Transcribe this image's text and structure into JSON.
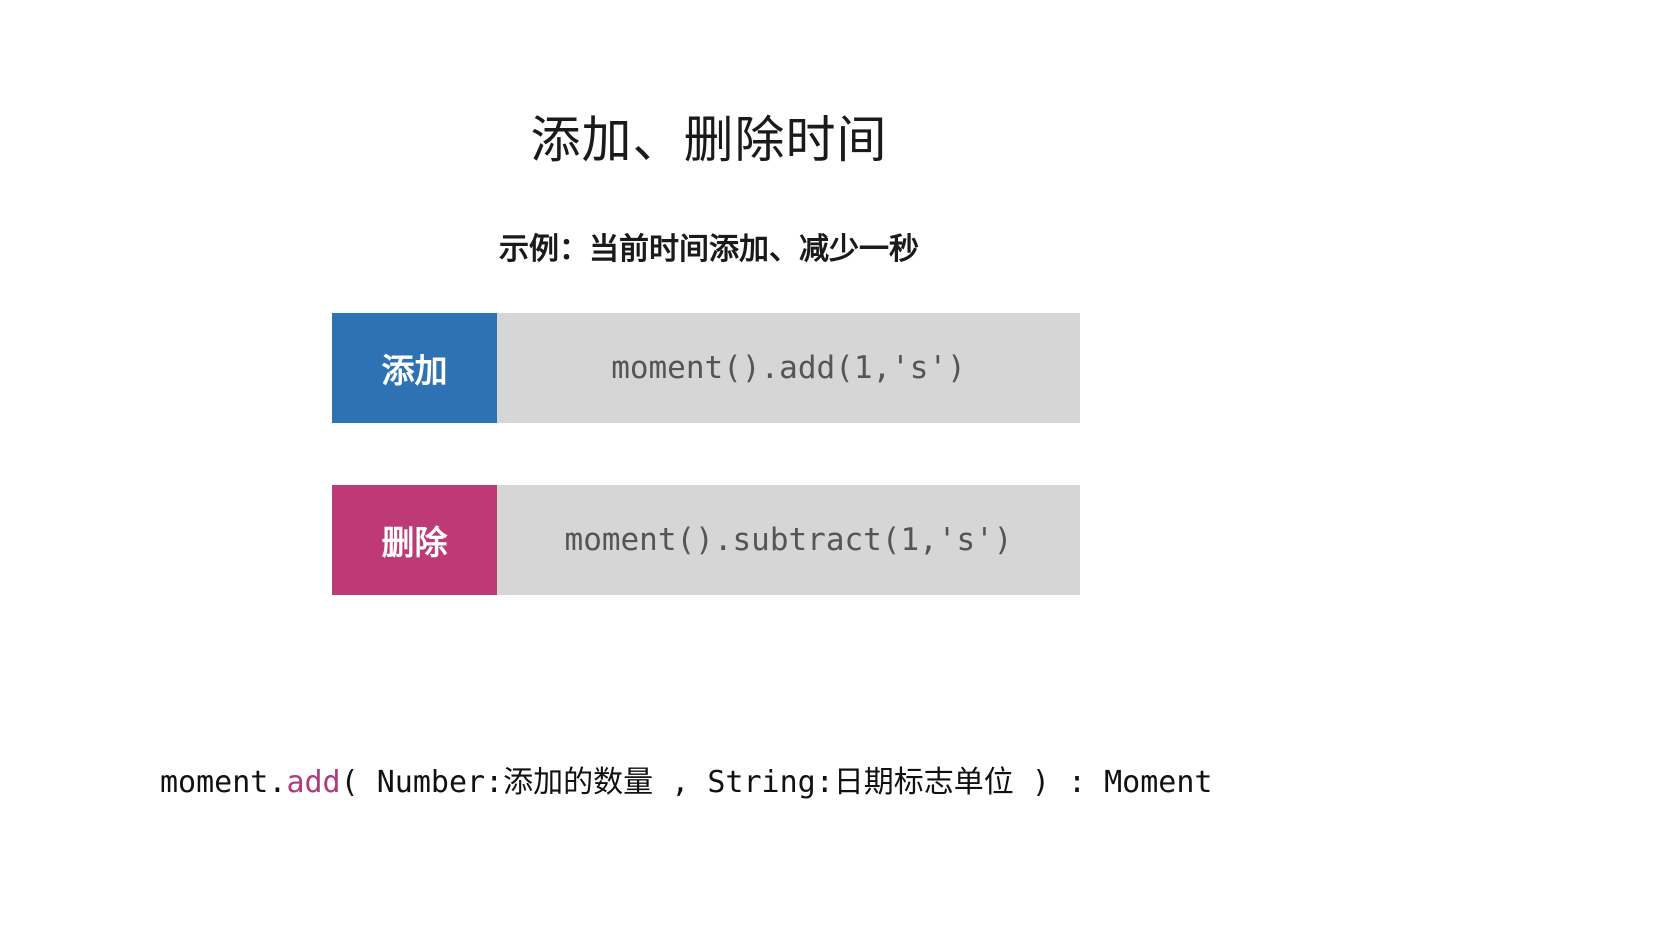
{
  "slide": {
    "title": "添加、删除时间",
    "subtitle": "示例：当前时间添加、减少一秒"
  },
  "examples": [
    {
      "label": "添加",
      "code": "moment().add(1,'s')",
      "color": "#2f72b4"
    },
    {
      "label": "删除",
      "code": "moment().subtract(1,'s')",
      "color": "#bd3a77"
    }
  ],
  "signature": {
    "prefix": "moment.",
    "method": "add",
    "rest": "( Number:添加的数量 , String:日期标志单位 ) : Moment",
    "method_color": "#b03a7e"
  },
  "colors": {
    "code_background": "#d6d6d6",
    "code_text": "#555555"
  }
}
